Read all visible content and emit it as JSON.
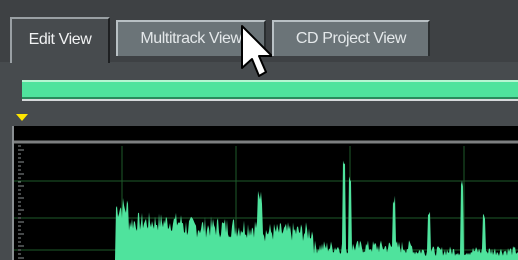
{
  "tabs": [
    {
      "label": "Edit View",
      "active": true
    },
    {
      "label": "Multitrack View",
      "active": false
    },
    {
      "label": "CD Project View",
      "active": false
    }
  ],
  "colors": {
    "waveform": "#4fe39d",
    "overview_bar": "#4fe39d",
    "background": "#000000",
    "grid": "#1e5a2a",
    "marker": "#ffe600"
  },
  "icons": {
    "pointer": "mouse-pointer-icon",
    "marker": "triangle-marker-icon"
  }
}
